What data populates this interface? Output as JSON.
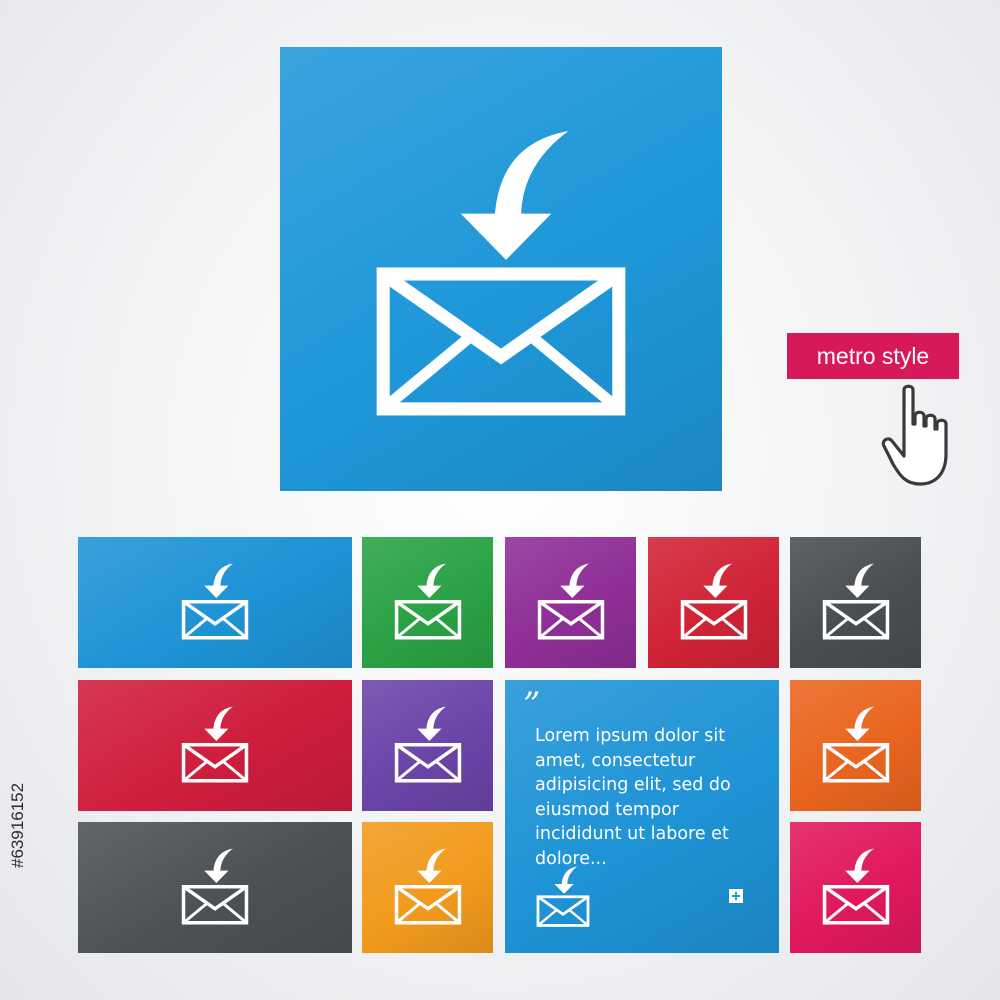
{
  "main_icon": {
    "icon": "mail-incoming-icon",
    "color": "#1e97d9"
  },
  "badge": {
    "label": "metro style",
    "color": "#d7195c"
  },
  "cursor": {
    "icon": "hand-pointer-icon"
  },
  "tiles": [
    {
      "name": "tile-blue-wide",
      "color": "#1e93d6",
      "icon": "mail-incoming-icon"
    },
    {
      "name": "tile-green",
      "color": "#2aa244",
      "icon": "mail-incoming-icon"
    },
    {
      "name": "tile-purple",
      "color": "#8f2e97",
      "icon": "mail-incoming-icon"
    },
    {
      "name": "tile-red",
      "color": "#d02336",
      "icon": "mail-incoming-icon"
    },
    {
      "name": "tile-dark-gray",
      "color": "#4a4d51",
      "icon": "mail-incoming-icon"
    },
    {
      "name": "tile-crimson-wide",
      "color": "#cf1d3d",
      "icon": "mail-incoming-icon"
    },
    {
      "name": "tile-violet",
      "color": "#6b44a8",
      "icon": "mail-incoming-icon"
    },
    {
      "name": "tile-orange",
      "color": "#e9651f",
      "icon": "mail-incoming-icon"
    },
    {
      "name": "tile-gray-wide",
      "color": "#4d5054",
      "icon": "mail-incoming-icon"
    },
    {
      "name": "tile-amber",
      "color": "#f29a1d",
      "icon": "mail-incoming-icon"
    },
    {
      "name": "tile-pink",
      "color": "#e1185d",
      "icon": "mail-incoming-icon"
    }
  ],
  "text_tile": {
    "color": "#1e93d6",
    "quote": "”",
    "text": "Lorem ipsum dolor sit amet, consectetur adipisicing elit, sed do eiusmod tempor incididunt ut labore et dolore...",
    "icon": "mail-incoming-icon",
    "plus_icon": "plus-icon"
  },
  "stock_id": "#63916152"
}
